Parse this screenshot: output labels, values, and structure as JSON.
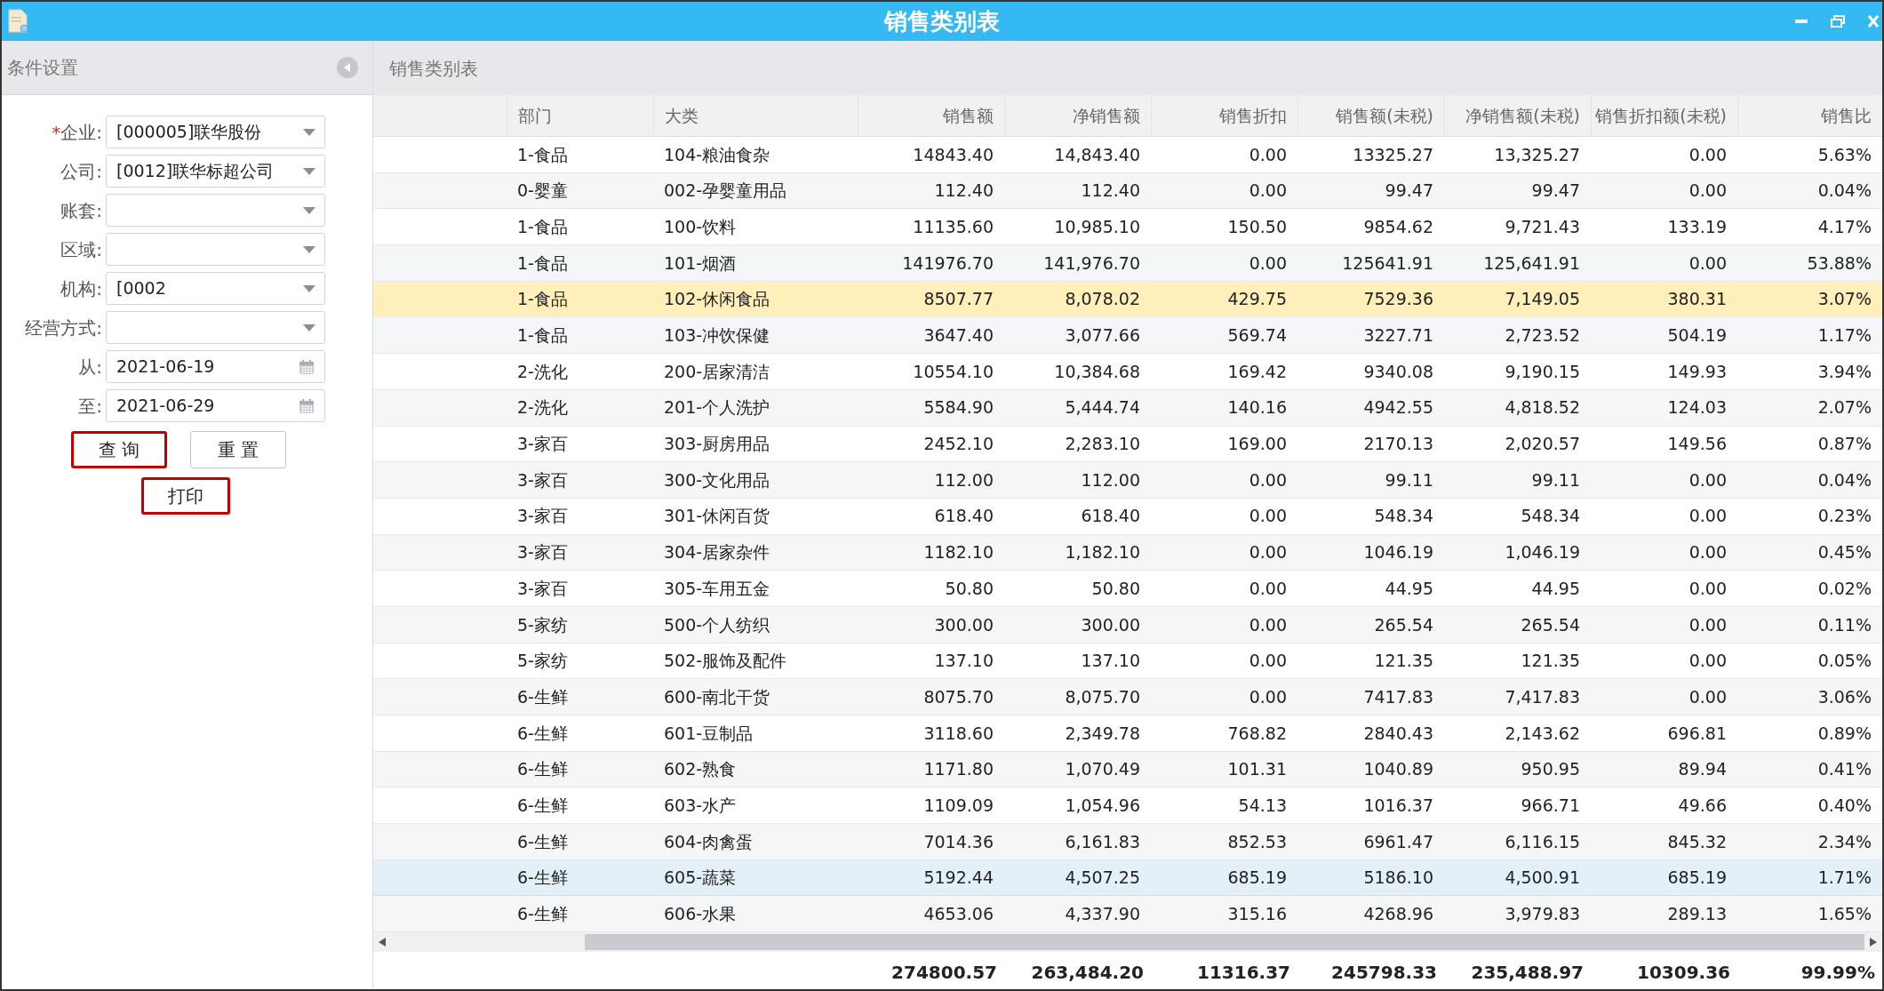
{
  "window": {
    "title": "销售类别表"
  },
  "sidebar": {
    "title": "条件设置",
    "fields": [
      {
        "label": "企业:",
        "required_mark": "*",
        "kind": "select",
        "value": "[000005]联华股份"
      },
      {
        "label": "公司:",
        "kind": "select",
        "value": "[0012]联华标超公司"
      },
      {
        "label": "账套:",
        "kind": "select"
      },
      {
        "label": "区域:",
        "kind": "select"
      },
      {
        "label": "机构:",
        "kind": "select",
        "value": "[0002"
      },
      {
        "label": "经营方式:",
        "kind": "select"
      },
      {
        "label": "从:",
        "kind": "date",
        "value": "2021-06-19"
      },
      {
        "label": "至:",
        "kind": "date",
        "value": "2021-06-29"
      }
    ],
    "buttons": [
      {
        "label": "查 询",
        "highlighted": true
      },
      {
        "label": "重 置",
        "highlighted": false
      }
    ],
    "print_button": {
      "label": "打印",
      "highlighted": true
    }
  },
  "report": {
    "title": "销售类别表",
    "columns": [
      "部门",
      "大类",
      "销售额",
      "净销售额",
      "销售折扣",
      "销售额(未税)",
      "净销售额(未税)",
      "销售折扣额(未税)",
      "销售比"
    ],
    "rows": [
      {
        "selected": false,
        "hovered": false,
        "cells": [
          "1-食品",
          "104-粮油食杂",
          "14843.40",
          "14,843.40",
          "0.00",
          "13325.27",
          "13,325.27",
          "0.00",
          "5.63%"
        ]
      },
      {
        "selected": false,
        "hovered": false,
        "cells": [
          "0-婴童",
          "002-孕婴童用品",
          "112.40",
          "112.40",
          "0.00",
          "99.47",
          "99.47",
          "0.00",
          "0.04%"
        ]
      },
      {
        "selected": false,
        "hovered": false,
        "cells": [
          "1-食品",
          "100-饮料",
          "11135.60",
          "10,985.10",
          "150.50",
          "9854.62",
          "9,721.43",
          "133.19",
          "4.17%"
        ]
      },
      {
        "selected": false,
        "hovered": false,
        "cells": [
          "1-食品",
          "101-烟酒",
          "141976.70",
          "141,976.70",
          "0.00",
          "125641.91",
          "125,641.91",
          "0.00",
          "53.88%"
        ]
      },
      {
        "selected": true,
        "hovered": false,
        "cells": [
          "1-食品",
          "102-休闲食品",
          "8507.77",
          "8,078.02",
          "429.75",
          "7529.36",
          "7,149.05",
          "380.31",
          "3.07%"
        ]
      },
      {
        "selected": false,
        "hovered": false,
        "cells": [
          "1-食品",
          "103-冲饮保健",
          "3647.40",
          "3,077.66",
          "569.74",
          "3227.71",
          "2,723.52",
          "504.19",
          "1.17%"
        ]
      },
      {
        "selected": false,
        "hovered": false,
        "cells": [
          "2-洗化",
          "200-居家清洁",
          "10554.10",
          "10,384.68",
          "169.42",
          "9340.08",
          "9,190.15",
          "149.93",
          "3.94%"
        ]
      },
      {
        "selected": false,
        "hovered": false,
        "cells": [
          "2-洗化",
          "201-个人洗护",
          "5584.90",
          "5,444.74",
          "140.16",
          "4942.55",
          "4,818.52",
          "124.03",
          "2.07%"
        ]
      },
      {
        "selected": false,
        "hovered": false,
        "cells": [
          "3-家百",
          "303-厨房用品",
          "2452.10",
          "2,283.10",
          "169.00",
          "2170.13",
          "2,020.57",
          "149.56",
          "0.87%"
        ]
      },
      {
        "selected": false,
        "hovered": false,
        "cells": [
          "3-家百",
          "300-文化用品",
          "112.00",
          "112.00",
          "0.00",
          "99.11",
          "99.11",
          "0.00",
          "0.04%"
        ]
      },
      {
        "selected": false,
        "hovered": false,
        "cells": [
          "3-家百",
          "301-休闲百货",
          "618.40",
          "618.40",
          "0.00",
          "548.34",
          "548.34",
          "0.00",
          "0.23%"
        ]
      },
      {
        "selected": false,
        "hovered": false,
        "cells": [
          "3-家百",
          "304-居家杂件",
          "1182.10",
          "1,182.10",
          "0.00",
          "1046.19",
          "1,046.19",
          "0.00",
          "0.45%"
        ]
      },
      {
        "selected": false,
        "hovered": false,
        "cells": [
          "3-家百",
          "305-车用五金",
          "50.80",
          "50.80",
          "0.00",
          "44.95",
          "44.95",
          "0.00",
          "0.02%"
        ]
      },
      {
        "selected": false,
        "hovered": false,
        "cells": [
          "5-家纺",
          "500-个人纺织",
          "300.00",
          "300.00",
          "0.00",
          "265.54",
          "265.54",
          "0.00",
          "0.11%"
        ]
      },
      {
        "selected": false,
        "hovered": false,
        "cells": [
          "5-家纺",
          "502-服饰及配件",
          "137.10",
          "137.10",
          "0.00",
          "121.35",
          "121.35",
          "0.00",
          "0.05%"
        ]
      },
      {
        "selected": false,
        "hovered": false,
        "cells": [
          "6-生鲜",
          "600-南北干货",
          "8075.70",
          "8,075.70",
          "0.00",
          "7417.83",
          "7,417.83",
          "0.00",
          "3.06%"
        ]
      },
      {
        "selected": false,
        "hovered": false,
        "cells": [
          "6-生鲜",
          "601-豆制品",
          "3118.60",
          "2,349.78",
          "768.82",
          "2840.43",
          "2,143.62",
          "696.81",
          "0.89%"
        ]
      },
      {
        "selected": false,
        "hovered": false,
        "cells": [
          "6-生鲜",
          "602-熟食",
          "1171.80",
          "1,070.49",
          "101.31",
          "1040.89",
          "950.95",
          "89.94",
          "0.41%"
        ]
      },
      {
        "selected": false,
        "hovered": false,
        "cells": [
          "6-生鲜",
          "603-水产",
          "1109.09",
          "1,054.96",
          "54.13",
          "1016.37",
          "966.71",
          "49.66",
          "0.40%"
        ]
      },
      {
        "selected": false,
        "hovered": false,
        "cells": [
          "6-生鲜",
          "604-肉禽蛋",
          "7014.36",
          "6,161.83",
          "852.53",
          "6961.47",
          "6,116.15",
          "845.32",
          "2.34%"
        ]
      },
      {
        "selected": false,
        "hovered": true,
        "cells": [
          "6-生鲜",
          "605-蔬菜",
          "5192.44",
          "4,507.25",
          "685.19",
          "5186.10",
          "4,500.91",
          "685.19",
          "1.71%"
        ]
      },
      {
        "selected": false,
        "hovered": false,
        "cells": [
          "6-生鲜",
          "606-水果",
          "4653.06",
          "4,337.90",
          "315.16",
          "4268.96",
          "3,979.83",
          "289.13",
          "1.65%"
        ]
      }
    ],
    "totals": [
      "274800.57",
      "263,484.20",
      "11316.37",
      "245798.33",
      "235,488.97",
      "10309.36",
      "99.99%"
    ]
  }
}
